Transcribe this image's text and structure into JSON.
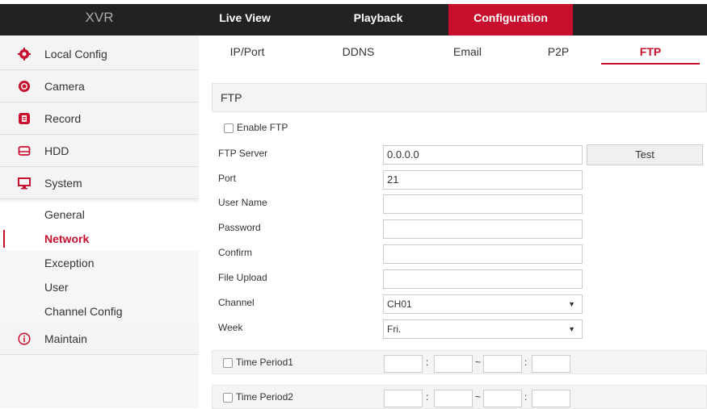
{
  "header": {
    "logo": "XVR",
    "nav": [
      {
        "label": "Live View",
        "active": false
      },
      {
        "label": "Playback",
        "active": false
      },
      {
        "label": "Configuration",
        "active": true
      }
    ]
  },
  "sidebar": {
    "items": [
      {
        "label": "Local Config",
        "icon": "gear-icon"
      },
      {
        "label": "Camera",
        "icon": "camera-icon"
      },
      {
        "label": "Record",
        "icon": "record-icon"
      },
      {
        "label": "HDD",
        "icon": "hdd-icon"
      },
      {
        "label": "System",
        "icon": "monitor-icon"
      }
    ],
    "system_sub": [
      {
        "label": "General",
        "active": false
      },
      {
        "label": "Network",
        "active": true
      },
      {
        "label": "Exception",
        "active": false
      },
      {
        "label": "User",
        "active": false
      },
      {
        "label": "Channel Config",
        "active": false
      }
    ],
    "maintain": {
      "label": "Maintain",
      "icon": "info-icon"
    }
  },
  "tabs": [
    {
      "label": "IP/Port",
      "active": false
    },
    {
      "label": "DDNS",
      "active": false
    },
    {
      "label": "Email",
      "active": false
    },
    {
      "label": "P2P",
      "active": false
    },
    {
      "label": "FTP",
      "active": true
    }
  ],
  "ftp": {
    "section_title": "FTP",
    "enable_label": "Enable FTP",
    "enable_checked": false,
    "fields": {
      "server": {
        "label": "FTP Server",
        "value": "0.0.0.0"
      },
      "port": {
        "label": "Port",
        "value": "21"
      },
      "username": {
        "label": "User Name",
        "value": ""
      },
      "password": {
        "label": "Password",
        "value": ""
      },
      "confirm": {
        "label": "Confirm",
        "value": ""
      },
      "file_upload": {
        "label": "File Upload",
        "value": ""
      },
      "channel": {
        "label": "Channel",
        "value": "CH01"
      },
      "week": {
        "label": "Week",
        "value": "Fri."
      }
    },
    "test_button": "Test",
    "periods": [
      {
        "label": "Time Period1"
      },
      {
        "label": "Time Period2"
      }
    ],
    "colon": ":",
    "tilde": "~"
  },
  "colors": {
    "accent": "#c8102e",
    "topbar": "#222222"
  }
}
